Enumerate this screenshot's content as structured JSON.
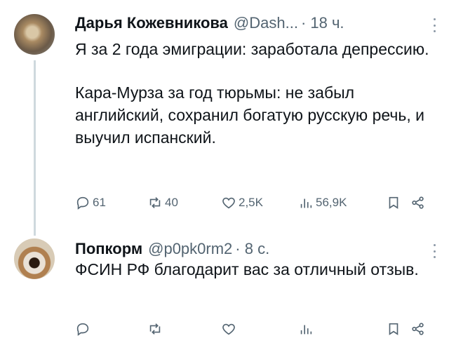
{
  "tweet1": {
    "name": "Дарья Кожевникова",
    "handle": "@Dash...",
    "time": "· 18 ч.",
    "text_p1": "Я за 2 года эмиграции: заработала депрессию.",
    "text_p2": "Кара-Мурза за год тюрьмы: не забыл английский, сохранил богатую русскую речь, и выучил испанский.",
    "replies": "61",
    "retweets": "40",
    "likes": "2,5K",
    "views": "56,9K"
  },
  "tweet2": {
    "name": "Попкорм",
    "handle": "@p0pk0rm2",
    "time": "· 8 с.",
    "text": "ФСИН РФ благодарит вас за отличный отзыв."
  },
  "icons": [
    "reply-icon",
    "retweet-icon",
    "like-icon",
    "views-icon",
    "bookmark-icon",
    "share-icon",
    "more-icon"
  ],
  "colors": {
    "text": "#0f1419",
    "secondary": "#536471",
    "thread": "#cfd9de"
  }
}
